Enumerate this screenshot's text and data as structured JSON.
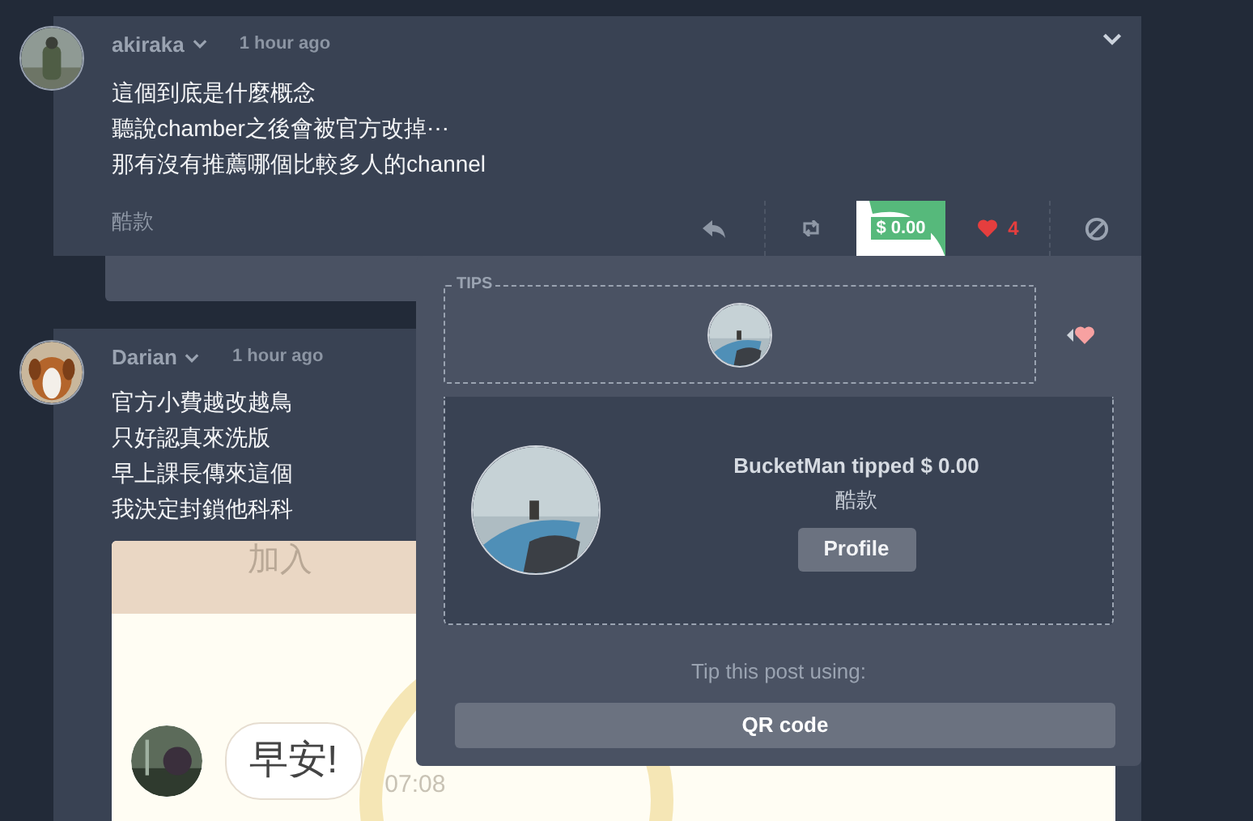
{
  "posts": [
    {
      "author": "akiraka",
      "time": "1 hour ago",
      "lines": [
        "這個到底是什麼概念",
        "聽說chamber之後會被官方改掉⋯",
        "那有沒有推薦哪個比較多人的channel"
      ],
      "tip_note": "酷款",
      "tip_amount": "$ 0.00",
      "likes": "4",
      "liked": true
    },
    {
      "author": "Darian",
      "time": "1 hour ago",
      "lines": [
        "官方小費越改越鳥",
        "只好認真來洗版",
        "早上課長傳來這個",
        "我決定封鎖他科科"
      ],
      "attachment": {
        "kind": "screenshot",
        "header": "加入",
        "message": "早安!",
        "time": "07:08"
      }
    }
  ],
  "tips_popover": {
    "label": "TIPS",
    "tipper": "BucketMan tipped $ 0.00",
    "note": "酷款",
    "profile_button": "Profile",
    "prompt": "Tip this post using:",
    "methods": [
      "QR code"
    ]
  }
}
